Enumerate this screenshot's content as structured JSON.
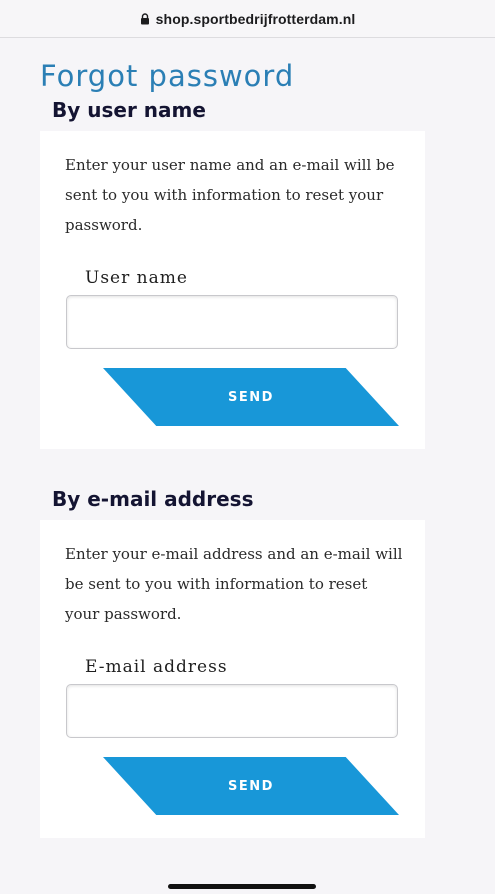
{
  "browser": {
    "url": "shop.sportbedrijfrotterdam.nl"
  },
  "page": {
    "title": "Forgot password"
  },
  "by_user_name": {
    "heading": "By user name",
    "description": "Enter your user name and an e-mail will be sent to you with information to reset your password.",
    "field_label": "User name",
    "input_value": "",
    "button_label": "SEND"
  },
  "by_email": {
    "heading": "By e-mail address",
    "description": "Enter your e-mail address and an e-mail will be sent to you with information to reset your password.",
    "field_label": "E-mail address",
    "input_value": "",
    "button_label": "SEND"
  },
  "colors": {
    "accent": "#1897d8",
    "title": "#2b7fb5",
    "heading": "#141432",
    "background": "#f6f5f8"
  },
  "icons": {
    "address_bar": "lock-icon"
  }
}
